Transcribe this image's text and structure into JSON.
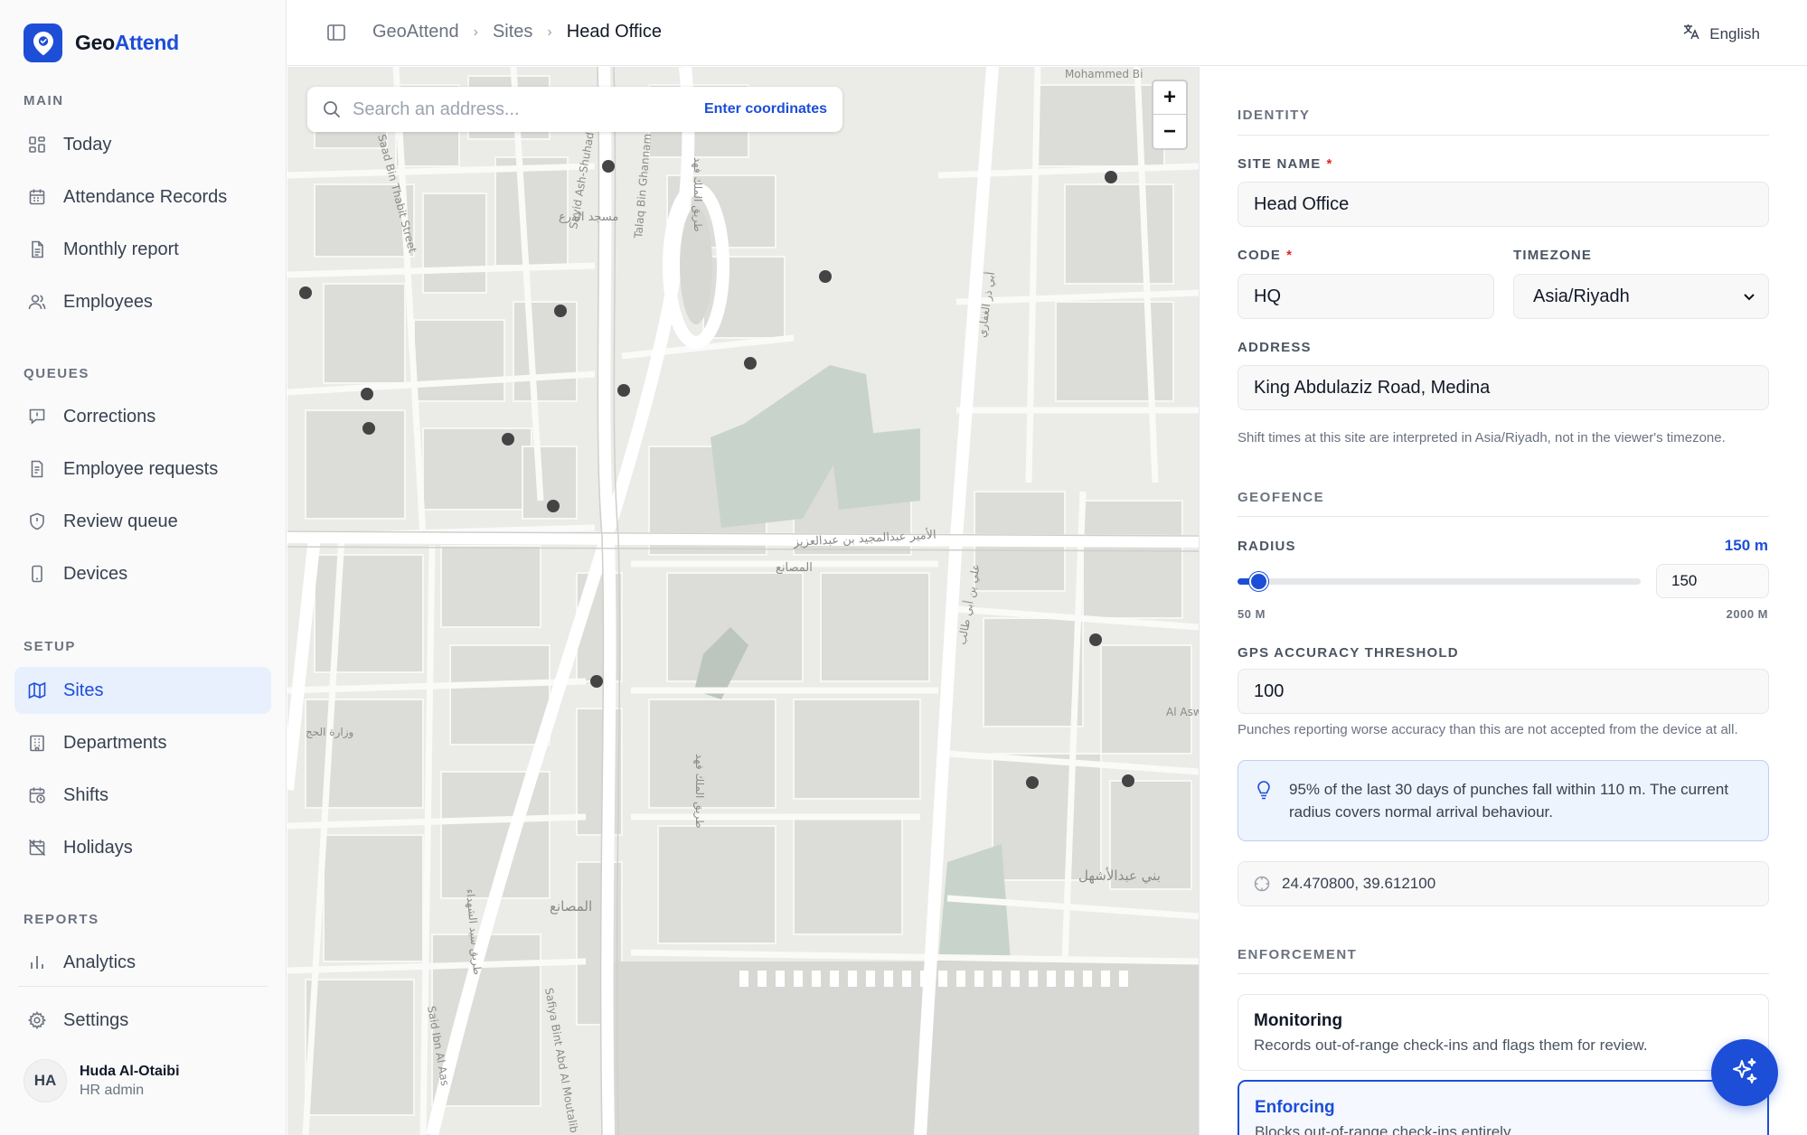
{
  "app": {
    "brand_geo": "Geo",
    "brand_attend": "Attend"
  },
  "sidebar": {
    "sections": {
      "main": "MAIN",
      "queues": "QUEUES",
      "setup": "SETUP",
      "reports": "REPORTS"
    },
    "items": [
      {
        "label": "Today",
        "icon": "grid-icon"
      },
      {
        "label": "Attendance Records",
        "icon": "calendar-icon"
      },
      {
        "label": "Monthly report",
        "icon": "file-text-icon"
      },
      {
        "label": "Employees",
        "icon": "users-icon"
      },
      {
        "label": "Corrections",
        "icon": "message-alert-icon"
      },
      {
        "label": "Employee requests",
        "icon": "file-list-icon"
      },
      {
        "label": "Review queue",
        "icon": "shield-icon"
      },
      {
        "label": "Devices",
        "icon": "phone-icon"
      },
      {
        "label": "Sites",
        "icon": "map-icon",
        "active": true
      },
      {
        "label": "Departments",
        "icon": "building-icon"
      },
      {
        "label": "Shifts",
        "icon": "calendar-clock-icon"
      },
      {
        "label": "Holidays",
        "icon": "calendar-off-icon"
      },
      {
        "label": "Analytics",
        "icon": "bar-chart-icon"
      },
      {
        "label": "Settings",
        "icon": "gear-icon"
      }
    ],
    "user": {
      "initials": "HA",
      "name": "Huda Al-Otaibi",
      "role": "HR admin"
    }
  },
  "topbar": {
    "breadcrumb": [
      "GeoAttend",
      "Sites",
      "Head Office"
    ],
    "language": "English"
  },
  "map": {
    "search_placeholder": "Search an address...",
    "enter_coordinates": "Enter coordinates",
    "zoom_in": "+",
    "zoom_out": "−",
    "labels": {
      "king_fahd": "طريق الملك فهد",
      "abdulmajeed": "الأمير عبدالمجيد بن عبدالعزيز",
      "masani": "المصانع",
      "bani_abdulashhal": "بني عبدالأشهل",
      "shuhada": "طريق سيد الشهداء",
      "saad": "Saad Bin Thabit Street",
      "sayid": "Sayid Ash-Shuhada Road",
      "talaq": "Talaq Bin Ghannam Street",
      "mohammed": "Mohammed Bi",
      "masjid_dira": "مسجد الدرع",
      "wizara": "وزارة الحج",
      "al_asw": "Al Asw Gard",
      "said_ibn": "Said Ibn Al Aas",
      "safiya": "Safiya Bint Abd Al Moutalib",
      "ali_ibn": "علي بن أبي طالب",
      "abu_dhar": "أبي ذر الغفاري"
    }
  },
  "form": {
    "identity_title": "IDENTITY",
    "site_name_label": "SITE NAME",
    "site_name": "Head Office",
    "code_label": "CODE",
    "code": "HQ",
    "timezone_label": "TIMEZONE",
    "timezone": "Asia/Riyadh",
    "address_label": "ADDRESS",
    "address": "King Abdulaziz Road, Medina",
    "timezone_hint": "Shift times at this site are interpreted in Asia/Riyadh, not in the viewer's timezone.",
    "geofence_title": "GEOFENCE",
    "radius_label": "RADIUS",
    "radius_display": "150 m",
    "radius_value": "150",
    "radius_min_label": "50 M",
    "radius_max_label": "2000 M",
    "radius_fraction": 0.051,
    "gps_label": "GPS ACCURACY THRESHOLD",
    "gps_value": "100",
    "gps_hint": "Punches reporting worse accuracy than this are not accepted from the device at all.",
    "insight": "95% of the last 30 days of punches fall within 110 m. The current radius covers normal arrival behaviour.",
    "coordinates": "24.470800, 39.612100",
    "enforcement_title": "ENFORCEMENT",
    "modes": [
      {
        "title": "Monitoring",
        "desc": "Records out-of-range check-ins and flags them for review."
      },
      {
        "title": "Enforcing",
        "desc": "Blocks out-of-range check-ins entirely."
      }
    ]
  },
  "colors": {
    "accent": "#1d4ed8",
    "required": "#dc2626"
  }
}
